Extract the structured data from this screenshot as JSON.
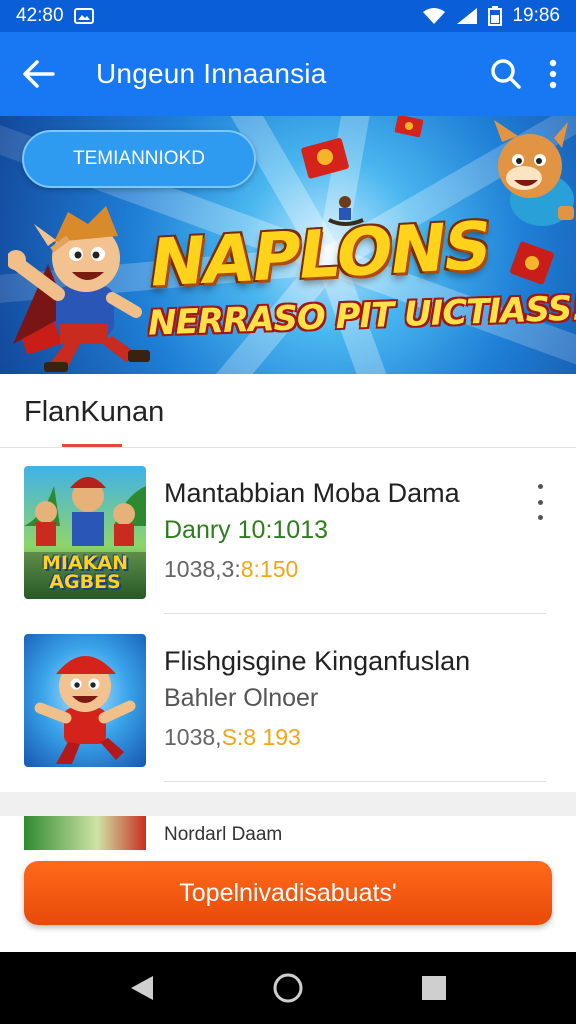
{
  "status_bar": {
    "time": "42:80",
    "clock_right": "19:86",
    "icons": [
      "photo-icon",
      "wifi-icon",
      "signal-icon",
      "battery-icon"
    ]
  },
  "app_bar": {
    "title": "Ungeun Innaansia",
    "icons": [
      "back-arrow-icon",
      "search-icon",
      "more-vert-icon"
    ]
  },
  "banner": {
    "chip_label": "TEMIANNIOKD",
    "title": "NAPLONS",
    "subtitle": "NERRASO PIT UICTIASS!"
  },
  "section": {
    "title": "FlanKunan"
  },
  "items": [
    {
      "title": "Mantabbian Moba Dama",
      "subtitle": "Danry 10:1013",
      "meta_prefix": "1038,3:",
      "meta_highlight": "8:150",
      "thumb_text": "MIAKAN AGBES",
      "has_menu": true
    },
    {
      "title": "Flishgisgine Kinganfuslan",
      "subtitle": "Bahler Olnoer",
      "meta_prefix": "1038,",
      "meta_highlight": "S:8 193",
      "has_menu": false
    }
  ],
  "peek_item": {
    "title": "Nordarl Daam"
  },
  "cta": {
    "label": "Topelnivadisabuats'"
  },
  "colors": {
    "primary": "#1877f2",
    "status_bar": "#0a5fd9",
    "accent_orange": "#ff6a1a",
    "accent_red": "#e8463c",
    "subtitle_green": "#2e7d1e",
    "highlight_orange": "#f2a516"
  },
  "nav_bar": {
    "icons": [
      "back-triangle-icon",
      "home-circle-icon",
      "recents-square-icon"
    ]
  }
}
